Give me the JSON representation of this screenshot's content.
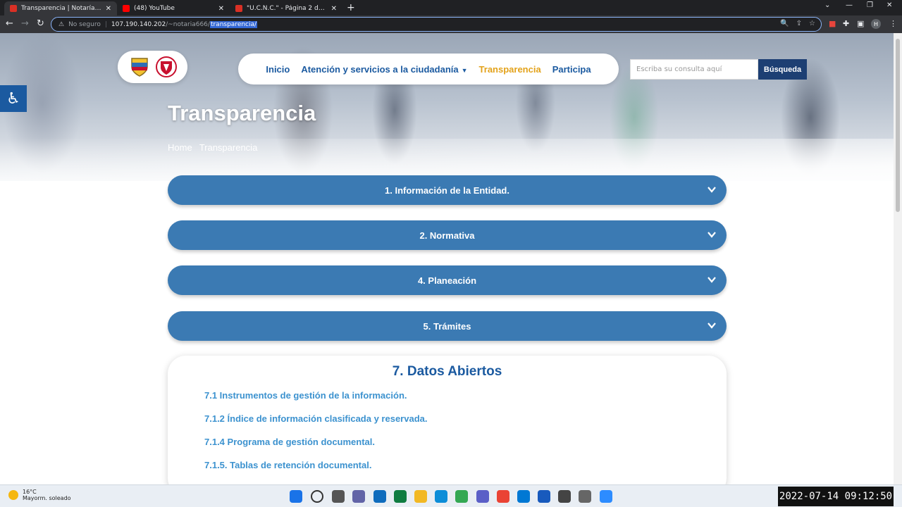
{
  "browser": {
    "tabs": [
      {
        "title": "Transparencia | Notaría Demo",
        "color": "#d93025"
      },
      {
        "title": "(48) YouTube",
        "color": "#ff0000"
      },
      {
        "title": "\"U.C.N.C.\" - Página 2 de 410 - U",
        "color": "#d93025"
      }
    ],
    "address": {
      "security": "No seguro",
      "host": "107.190.140.202",
      "path_plain": "/~notaria666/",
      "path_selected": "transparencia/"
    }
  },
  "site": {
    "nav": {
      "items": [
        "Inicio",
        "Atención y servicios a la ciudadanía",
        "Transparencia",
        "Participa"
      ],
      "active_index": 2
    },
    "search": {
      "placeholder": "Escriba su consulta aquí",
      "button": "Búsqueda"
    },
    "page_title": "Transparencia",
    "breadcrumb": [
      "Home",
      "Transparencia"
    ],
    "accordions": [
      "1. Información de la Entidad.",
      "2. Normativa",
      "4. Planeación",
      "5. Trámites"
    ],
    "datos_abiertos": {
      "title": "7. Datos Abiertos",
      "links": [
        "7.1 Instrumentos de gestión de la información.",
        "7.1.2 Índice de información clasificada y reservada.",
        "7.1.4 Programa de gestión documental.",
        "7.1.5. Tablas de retención documental."
      ]
    },
    "colors": {
      "primary": "#3b7ab3",
      "nav_text": "#1b5aa0",
      "active": "#e3a21a",
      "link": "#3c92cf"
    }
  },
  "taskbar": {
    "weather": {
      "temp": "16°C",
      "desc": "Mayorm. soleado"
    },
    "clock": "2022-07-14 09:12:50"
  }
}
